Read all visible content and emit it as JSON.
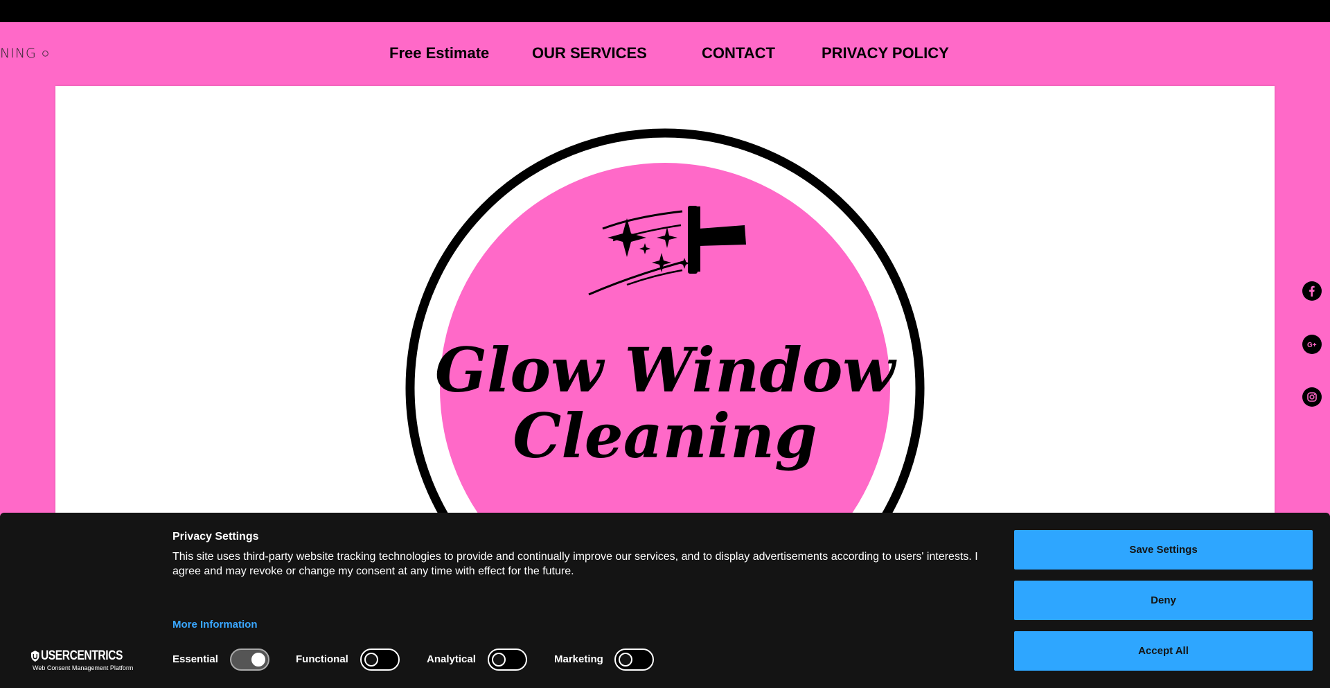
{
  "header": {
    "brand_fragment": "NING ○",
    "nav": {
      "free_estimate": "Free Estimate",
      "services": "OUR SERVICES",
      "contact": "CONTACT",
      "privacy": "PRIVACY POLICY"
    }
  },
  "hero": {
    "logo_line1": "Glow Window",
    "logo_line2": "Cleaning"
  },
  "social": [
    "facebook-icon",
    "google-plus-icon",
    "instagram-icon"
  ],
  "consent": {
    "title": "Privacy Settings",
    "text": "This site uses third-party website tracking technologies to provide and continually improve our services, and to display advertisements according to users' interests. I agree and may revoke or change my consent at any time with effect for the future.",
    "more_info": "More Information",
    "vendor_name": "USERCENTRICS",
    "vendor_sub": "Web Consent Management Platform",
    "toggles": [
      {
        "label": "Essential",
        "on": true
      },
      {
        "label": "Functional",
        "on": false
      },
      {
        "label": "Analytical",
        "on": false
      },
      {
        "label": "Marketing",
        "on": false
      }
    ],
    "buttons": {
      "save": "Save Settings",
      "deny": "Deny",
      "accept": "Accept All"
    }
  },
  "colors": {
    "brand_pink": "#ff69c8",
    "accent_blue": "#2ea6ff",
    "link_blue": "#3aa7ff",
    "banner_bg": "#141414"
  }
}
